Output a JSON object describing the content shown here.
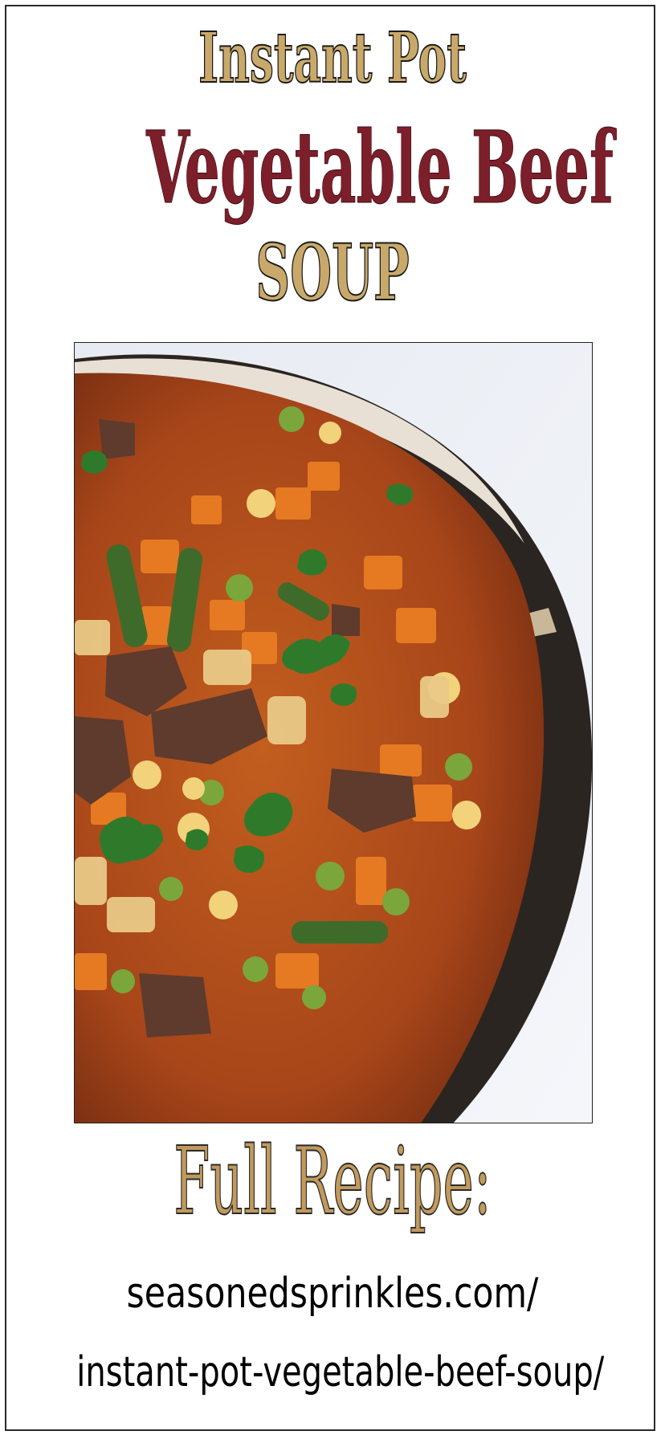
{
  "title": {
    "line1": "Instant Pot",
    "line2": "Vegetable Beef",
    "line3": "SOUP"
  },
  "photo": {
    "subject": "soup-bowl-photo"
  },
  "cta": {
    "label": "Full Recipe:",
    "url_line1": "seasonedsprinkles.com/",
    "url_line2": "instant-pot-vegetable-beef-soup/"
  },
  "colors": {
    "gold": "#c9a96a",
    "burgundy": "#7d1f2a",
    "broth": "#b24a1a",
    "carrot": "#e67a22",
    "green_bean": "#3f6b2a",
    "pea": "#7aa63b",
    "beef": "#5e3b2c",
    "bowl_rim": "#2b2521"
  }
}
